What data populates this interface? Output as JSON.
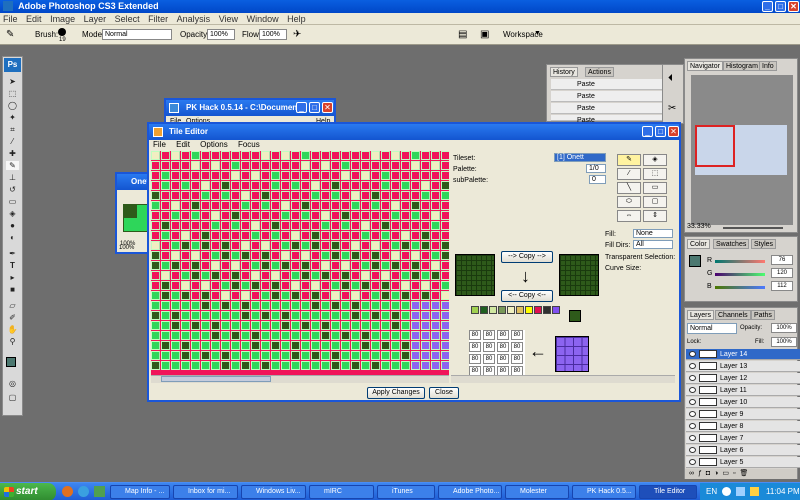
{
  "app": {
    "title": "Adobe Photoshop CS3 Extended"
  },
  "menu": [
    "File",
    "Edit",
    "Image",
    "Layer",
    "Select",
    "Filter",
    "Analysis",
    "View",
    "Window",
    "Help"
  ],
  "options": {
    "brush_label": "Brush:",
    "brush_size": "19",
    "mode_label": "Mode:",
    "mode_value": "Normal",
    "opacity_label": "Opacity:",
    "opacity_value": "100%",
    "flow_label": "Flow:",
    "flow_value": "100%",
    "workspace": "Workspace"
  },
  "toolbox": {
    "logo": "Ps"
  },
  "history": {
    "tabs": [
      "History",
      "Actions"
    ],
    "rows": [
      "Paste",
      "Paste",
      "Paste",
      "Paste"
    ]
  },
  "navigator": {
    "tabs": [
      "Navigator",
      "Histogram",
      "Info"
    ],
    "zoom": "33.33%"
  },
  "color": {
    "tabs": [
      "Color",
      "Swatches",
      "Styles"
    ],
    "r_label": "R",
    "g_label": "G",
    "b_label": "B",
    "r": "76",
    "g": "120",
    "b": "112",
    "fg": "#4c7870"
  },
  "layers": {
    "tabs": [
      "Layers",
      "Channels",
      "Paths"
    ],
    "mode": "Normal",
    "opacity_label": "Opacity:",
    "opacity": "100%",
    "lock_label": "Lock:",
    "fill_label": "Fill:",
    "fill": "100%",
    "items": [
      "Layer 14",
      "Layer 13",
      "Layer 12",
      "Layer 11",
      "Layer 10",
      "Layer 9",
      "Layer 8",
      "Layer 7",
      "Layer 6",
      "Layer 5"
    ]
  },
  "pkhack": {
    "title": "PK Hack 0.5.14 - C:\\Documen...",
    "menu": [
      "File",
      "Options"
    ],
    "help": "Help"
  },
  "onett": {
    "title": "Onet",
    "zoom": "100%",
    "zoom2": "100%"
  },
  "tile_editor": {
    "title": "Tile Editor",
    "menu": [
      "File",
      "Edit",
      "Options",
      "Focus"
    ],
    "tileset_label": "Tileset:",
    "tileset_value": "[1] Onett",
    "palette_label": "Palette:",
    "palette_value": "1/0",
    "subpalette_label": "subPalette:",
    "subpalette_value": "0",
    "fill_label": "Fill:",
    "fill_value": "None",
    "filldirs_label": "Fill Dirs:",
    "filldirs_value": "All",
    "transparent_label": "Transparent Selection:",
    "curve_label": "Curve Size:",
    "copy_right": "--> Copy -->",
    "copy_left": "<-- Copy <--",
    "apply": "Apply Changes",
    "close": "Close",
    "numbers": [
      [
        "80",
        "80",
        "80",
        "80"
      ],
      [
        "80",
        "80",
        "80",
        "80"
      ],
      [
        "80",
        "80",
        "80",
        "80"
      ],
      [
        "80",
        "80",
        "80",
        "80"
      ]
    ],
    "palette_colors": [
      "#a0d050",
      "#206020",
      "#d0e8a0",
      "#789858",
      "#f0f0c0",
      "#e0c060",
      "#ffff00",
      "#e01050",
      "#303030",
      "#8050f0"
    ],
    "colors": {
      "magenta": "#f0145a",
      "green": "#2ed65a",
      "dark": "#2e5a1a",
      "lilac": "#8c64f0",
      "cream": "#f2eec2"
    }
  },
  "taskbar": {
    "start": "start",
    "tasks": [
      "Map Info - ...",
      "Inbox for mi...",
      "Windows Liv...",
      "mIRC",
      "iTunes",
      "Adobe Photo...",
      "Molester",
      "PK Hack 0.5...",
      "Tile Editor"
    ],
    "lang": "EN",
    "time": "11:04 PM"
  }
}
